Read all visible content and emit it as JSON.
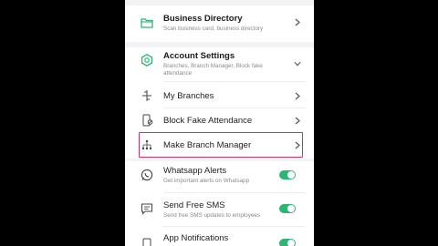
{
  "colors": {
    "accent": "#2bb673",
    "highlight_border": "#cc3366"
  },
  "menu": {
    "business_directory": {
      "title": "Business Directory",
      "subtitle": "Scan business card, business directory",
      "icon": "folder-icon"
    },
    "account_settings": {
      "title": "Account Settings",
      "subtitle": "Branches, Branch Manager, Block fake attendance",
      "icon": "gear-icon"
    },
    "my_branches": {
      "title": "My Branches",
      "icon": "branch-icon"
    },
    "block_fake_attendance": {
      "title": "Block Fake Attendance",
      "icon": "phone-block-icon"
    },
    "make_branch_manager": {
      "title": "Make Branch Manager",
      "icon": "hierarchy-icon"
    },
    "whatsapp_alerts": {
      "title": "Whatsapp Alerts",
      "subtitle": "Get important alerts on Whatsapp",
      "icon": "whatsapp-icon",
      "enabled": true
    },
    "send_free_sms": {
      "title": "Send Free SMS",
      "subtitle": "Send free SMS updates to employees",
      "icon": "sms-icon",
      "enabled": true
    },
    "app_notifications": {
      "title": "App Notifications",
      "icon": "bell-icon",
      "enabled": true
    }
  }
}
